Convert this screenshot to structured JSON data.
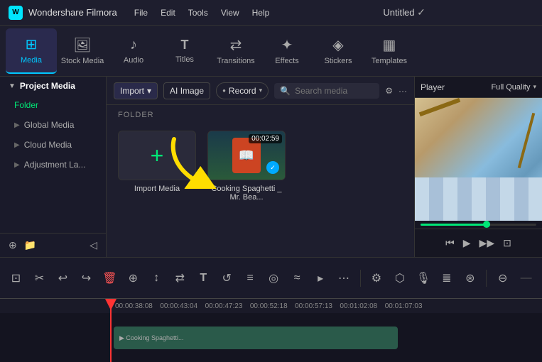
{
  "app": {
    "name": "Wondershare Filmora",
    "title": "Untitled",
    "logo": "W"
  },
  "menu": {
    "items": [
      "File",
      "Edit",
      "Tools",
      "View",
      "Help"
    ]
  },
  "toolbar": {
    "items": [
      {
        "id": "media",
        "label": "Media",
        "icon": "▦",
        "active": true
      },
      {
        "id": "stock-media",
        "label": "Stock Media",
        "icon": "🖼",
        "active": false
      },
      {
        "id": "audio",
        "label": "Audio",
        "icon": "♪",
        "active": false
      },
      {
        "id": "titles",
        "label": "Titles",
        "icon": "T",
        "active": false
      },
      {
        "id": "transitions",
        "label": "Transitions",
        "icon": "⇄",
        "active": false
      },
      {
        "id": "effects",
        "label": "Effects",
        "icon": "✦",
        "active": false
      },
      {
        "id": "stickers",
        "label": "Stickers",
        "icon": "◈",
        "active": false
      },
      {
        "id": "templates",
        "label": "Templates",
        "icon": "⊞",
        "active": false
      }
    ]
  },
  "sidebar": {
    "header": "Project Media",
    "items": [
      {
        "id": "folder",
        "label": "Folder",
        "active": true
      },
      {
        "id": "global-media",
        "label": "Global Media",
        "active": false
      },
      {
        "id": "cloud-media",
        "label": "Cloud Media",
        "active": false
      },
      {
        "id": "adjustment-la",
        "label": "Adjustment La...",
        "active": false
      }
    ]
  },
  "content_toolbar": {
    "import_label": "Import",
    "ai_image_label": "AI Image",
    "record_label": "Record",
    "search_placeholder": "Search media"
  },
  "folder_label": "FOLDER",
  "media_items": [
    {
      "id": "import",
      "label": "Import Media",
      "type": "import"
    },
    {
      "id": "cooking",
      "label": "Cooking Spaghetti _ Mr. Bea...",
      "type": "video",
      "duration": "00:02:59",
      "checked": true
    }
  ],
  "preview": {
    "player_label": "Player",
    "quality_label": "Full Quality"
  },
  "bottom_toolbar": {
    "icons": [
      "⊡",
      "⊘",
      "↩",
      "↪",
      "🗑",
      "⊕",
      "↕",
      "⇄",
      "T",
      "↺",
      "≡",
      "◎",
      "≈",
      "▸",
      "⋯",
      "⚙",
      "⬡",
      "🎙",
      "≣",
      "⊛",
      "⊖",
      "—"
    ]
  },
  "timeline": {
    "timestamps": [
      "00:00:38:08",
      "00:00:43:04",
      "00:00:47:23",
      "00:00:52:18",
      "00:00:57:13",
      "00:01:02:08",
      "00:01:07:03"
    ]
  }
}
